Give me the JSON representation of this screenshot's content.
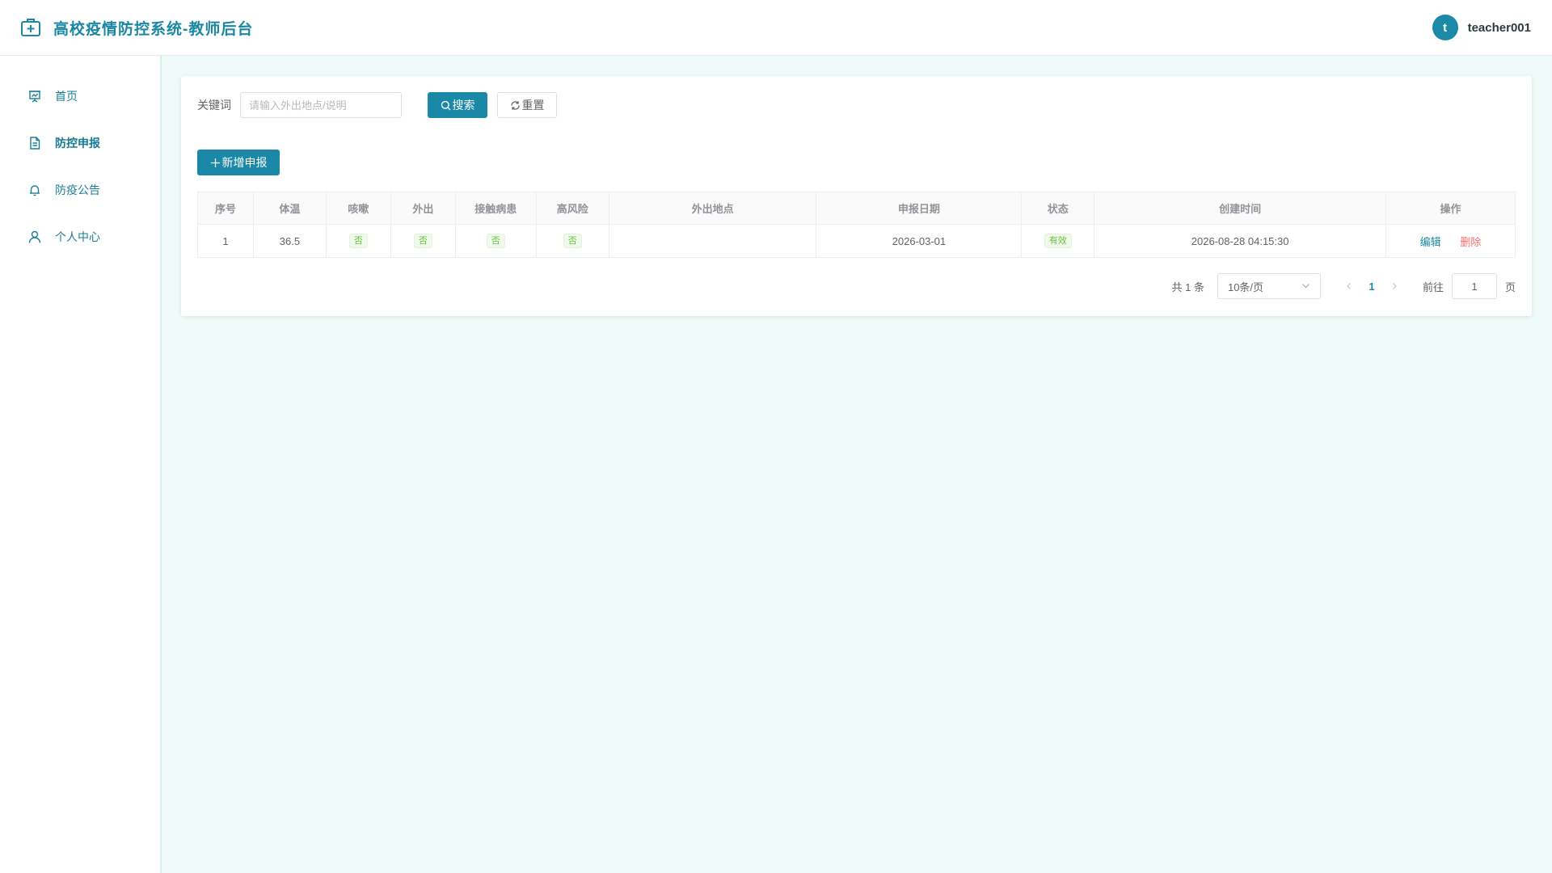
{
  "header": {
    "title": "高校疫情防控系统-教师后台",
    "user": {
      "avatar_letter": "t",
      "name": "teacher001"
    }
  },
  "sidebar": {
    "items": [
      {
        "label": "首页",
        "icon": "presentation-icon",
        "active": false
      },
      {
        "label": "防控申报",
        "icon": "document-icon",
        "active": true
      },
      {
        "label": "防疫公告",
        "icon": "bell-icon",
        "active": false
      },
      {
        "label": "个人中心",
        "icon": "user-icon",
        "active": false
      }
    ]
  },
  "search": {
    "label": "关键词",
    "placeholder": "请输入外出地点/说明",
    "value": "",
    "search_button": "搜索",
    "reset_button": "重置"
  },
  "add_button": "新增申报",
  "table": {
    "columns": [
      "序号",
      "体温",
      "咳嗽",
      "外出",
      "接触病患",
      "高风险",
      "外出地点",
      "申报日期",
      "状态",
      "创建时间",
      "操作"
    ],
    "rows": [
      {
        "index": "1",
        "temperature": "36.5",
        "cough": "否",
        "went_out": "否",
        "contact": "否",
        "high_risk": "否",
        "location": "",
        "report_date": "2026-03-01",
        "status": "有效",
        "created_at": "2026-08-28 04:15:30",
        "edit": "编辑",
        "delete": "删除"
      }
    ]
  },
  "pagination": {
    "total": "共 1 条",
    "page_size": "10条/页",
    "current_page": "1",
    "goto_label": "前往",
    "goto_value": "1",
    "page_suffix": "页"
  },
  "colors": {
    "primary": "#1a88a6",
    "tag_green": "#67c23a",
    "danger": "#f56c6c",
    "background": "#f0fbf9"
  }
}
